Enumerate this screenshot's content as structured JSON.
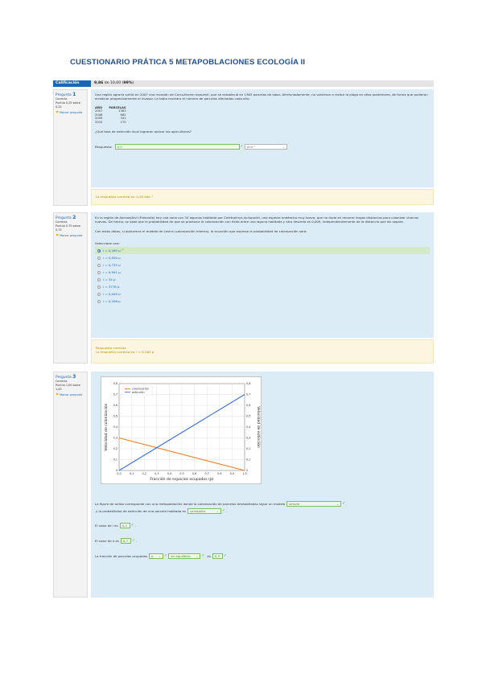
{
  "doc": {
    "title": "CUESTIONARIO PRÁTICA 5 METAPOBLACIONES ECOLOGÍA II"
  },
  "grade": {
    "label": "Calificación",
    "score": "9,86",
    "rest": " de 10,00 (",
    "percent": "99%",
    "close": ")"
  },
  "q1": {
    "label": "Pregunta",
    "number": "1",
    "status": "Correcta",
    "points": "Puntúa 0,25 sobre 0,25",
    "flag": "Marcar pregunta",
    "text_a": "Una región agraria sufrió en 2007 una invasión de ",
    "text_species": "Curculionem expuesti",
    "text_b": ", que se estableció en 1363 parcelas de labor. ",
    "text_c": "Afortunadamente",
    "text_d": ", no volvieron a recibir la plaga en años posteriores, de forma que pudieron erradicar progresivamente al invasor. La tabla muestra el número de parcelas afectadas cada año:",
    "table_headers": [
      "AÑO",
      "PARCELAS"
    ],
    "table_rows": [
      [
        "2007",
        "1363"
      ],
      [
        "2008",
        "682"
      ],
      [
        "2009",
        "341"
      ],
      [
        "2010",
        "170"
      ]
    ],
    "question": "¿Qué tasa de extinción local lograron aplicar los agricultores?",
    "answer_label": "Respuesta:",
    "answer_value": "0,5",
    "unit_value": "año⁻¹",
    "feedback": "La respuesta correcta es: 0,50 año⁻¹"
  },
  "q2": {
    "label": "Pregunta",
    "number": "2",
    "status": "Correcta",
    "points": "Puntúa 0,75 sobre 0,75",
    "flag": "Marcar pregunta",
    "text_a": "En la región de Aarnanjärvi (Finlandia) hay una zona con 34 lagunas habitada por ",
    "text_species": "Celetophrys joulupukki",
    "text_b": ", una especie endémica muy brava, que no duda en recorrer largas distancias para colonizar charcas nuevas. De hecho, se sabe que la probabilidad de que se produzca la colonización con éxito entre una laguna habitada y otra desierta es 0,009, independientemente de la distancia que las separe.",
    "text_c": "Con estos datos, si aplicamos el modelo de Levins (colonización interna), la ecuación que expresa la probabilidad de colonización será:",
    "select_label": "Seleccione una:",
    "options": [
      "i = 0,265 p",
      "i = 0,000 p",
      "i = 0,735 p",
      "i = 0,991 p",
      "i = 34 p",
      "i = 3778 p",
      "i = 0,009 p",
      "i = 0,306 p"
    ],
    "feedback_a": "Respuesta correcta",
    "feedback_b": "La respuesta correcta es: i = 0,265 p"
  },
  "q3": {
    "label": "Pregunta",
    "number": "3",
    "status": "Correcta",
    "points": "Puntúa 1,00 sobre 1,00",
    "flag": "Marcar pregunta",
    "text_a": "La figura de arriba corresponde con una metapoblación donde la colonización de parcelas deshabitadas sigue un modelo",
    "sel_model": "simple",
    "text_b": "y la probabilidad de extinción de una parcela habitada es",
    "sel_prob": "constante",
    "i_label": "El valor de i es",
    "i_value": "0,3",
    "e_label": "El valor de e es",
    "e_value": "0,7",
    "frac_label": "La fracción de parcelas ocupadas",
    "sel_p": "p",
    "sel_eq": "en equilibrio",
    "es_label": "es",
    "frac_value": "0,3"
  },
  "chart_data": {
    "type": "line",
    "xlabel": "Fracción de espacios ocupados (p)",
    "ylabel": "Velocidad de colonización",
    "ylabel_right": "Velocidad de extinción",
    "xlim": [
      0,
      1.0
    ],
    "ylim": [
      0,
      0.8
    ],
    "xticks": [
      "0,0",
      "0,1",
      "0,2",
      "0,3",
      "0,4",
      "0,5",
      "0,6",
      "0,7",
      "0,8",
      "0,9",
      "1,0"
    ],
    "yticks": [
      "0",
      "0,1",
      "0,2",
      "0,3",
      "0,4",
      "0,5",
      "0,6",
      "0,7",
      "0,8"
    ],
    "grid": true,
    "legend": "top-left",
    "series": [
      {
        "name": "colonización",
        "color": "#f07c1e",
        "x": [
          0,
          1.0
        ],
        "y": [
          0.3,
          0
        ]
      },
      {
        "name": "extinción",
        "color": "#3a6fe0",
        "x": [
          0,
          1.0
        ],
        "y": [
          0,
          0.7
        ]
      }
    ]
  }
}
